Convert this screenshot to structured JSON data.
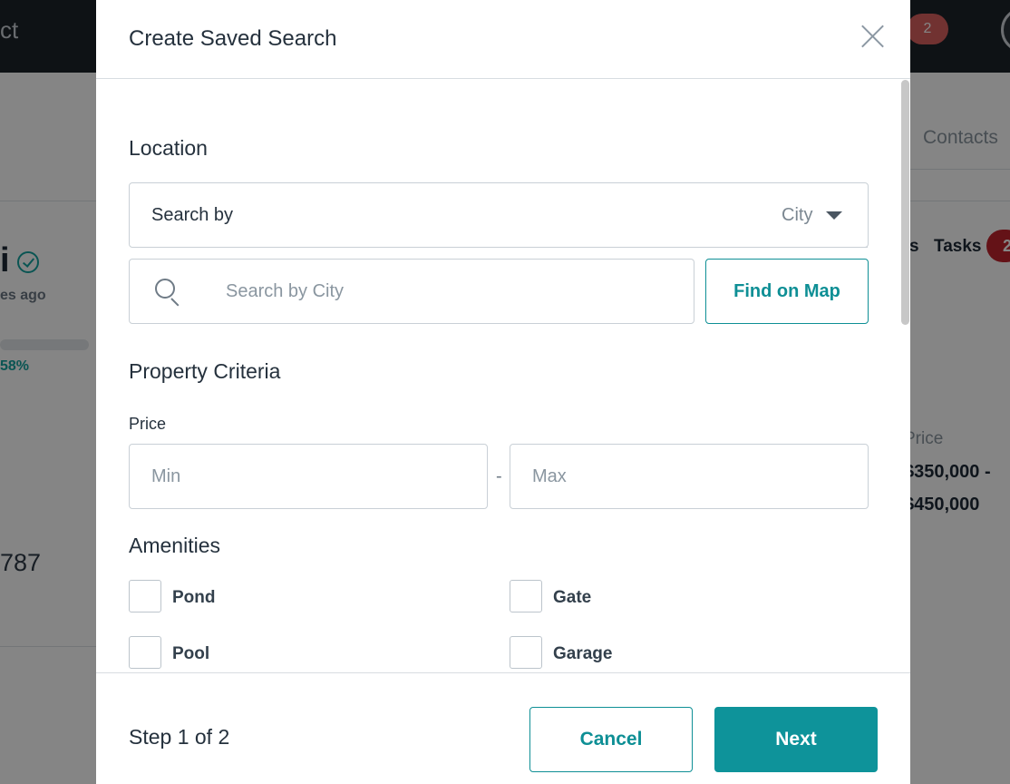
{
  "background": {
    "top_left_text": "ct",
    "notification_count": "2",
    "contacts_tab": "Contacts",
    "contact_name_fragment": "i",
    "last_updated_fragment": "es ago",
    "progress_label": "58%",
    "tab_fragment": "s",
    "tasks_tab": "Tasks",
    "tasks_count": "2",
    "price_label": "Price",
    "price_range_line1": "$350,000 -",
    "price_range_line2": "$450,000",
    "phone_fragment": "787"
  },
  "modal": {
    "title": "Create Saved Search",
    "location": {
      "heading": "Location",
      "search_by_label": "Search by",
      "search_by_value": "City",
      "search_placeholder": "Search by City",
      "find_on_map_label": "Find on Map"
    },
    "property_criteria": {
      "heading": "Property Criteria",
      "price_label": "Price",
      "min_placeholder": "Min",
      "separator": "-",
      "max_placeholder": "Max"
    },
    "amenities": {
      "heading": "Amenities",
      "items": [
        {
          "label": "Pond",
          "checked": false
        },
        {
          "label": "Gate",
          "checked": false
        },
        {
          "label": "Pool",
          "checked": false
        },
        {
          "label": "Garage",
          "checked": false
        }
      ]
    },
    "footer": {
      "step_text": "Step 1 of 2",
      "cancel_label": "Cancel",
      "next_label": "Next"
    }
  },
  "colors": {
    "accent": "#0e939a",
    "topbar": "#1c232a",
    "notification_badge": "#d9605f",
    "tasks_badge": "#c0242d",
    "text": "#25313d"
  }
}
